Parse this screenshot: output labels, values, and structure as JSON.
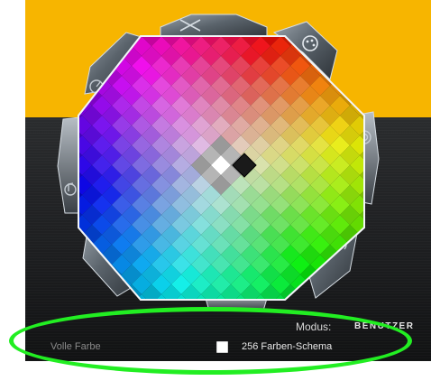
{
  "palette": {
    "selected_color": "#1a1a1a",
    "colors": {
      "yellow_background": "#f7b500",
      "dark_background": "#1c1d1f",
      "highlight": "#22ee22"
    }
  },
  "side_buttons": [
    {
      "icon": "shuffle-icon"
    },
    {
      "icon": "palette-icon"
    },
    {
      "icon": "speaker-icon"
    },
    {
      "icon": "refresh-icon"
    },
    {
      "icon": "sliders-icon"
    },
    {
      "icon": "music-note-icon"
    },
    {
      "icon": "gauge-icon"
    }
  ],
  "mode": {
    "label": "Modus:",
    "value": "BENUTZER"
  },
  "color_options": {
    "full_color": "Volle Farbe",
    "scheme_256": "256 Farben-Schema",
    "scheme_256_checked": false
  }
}
